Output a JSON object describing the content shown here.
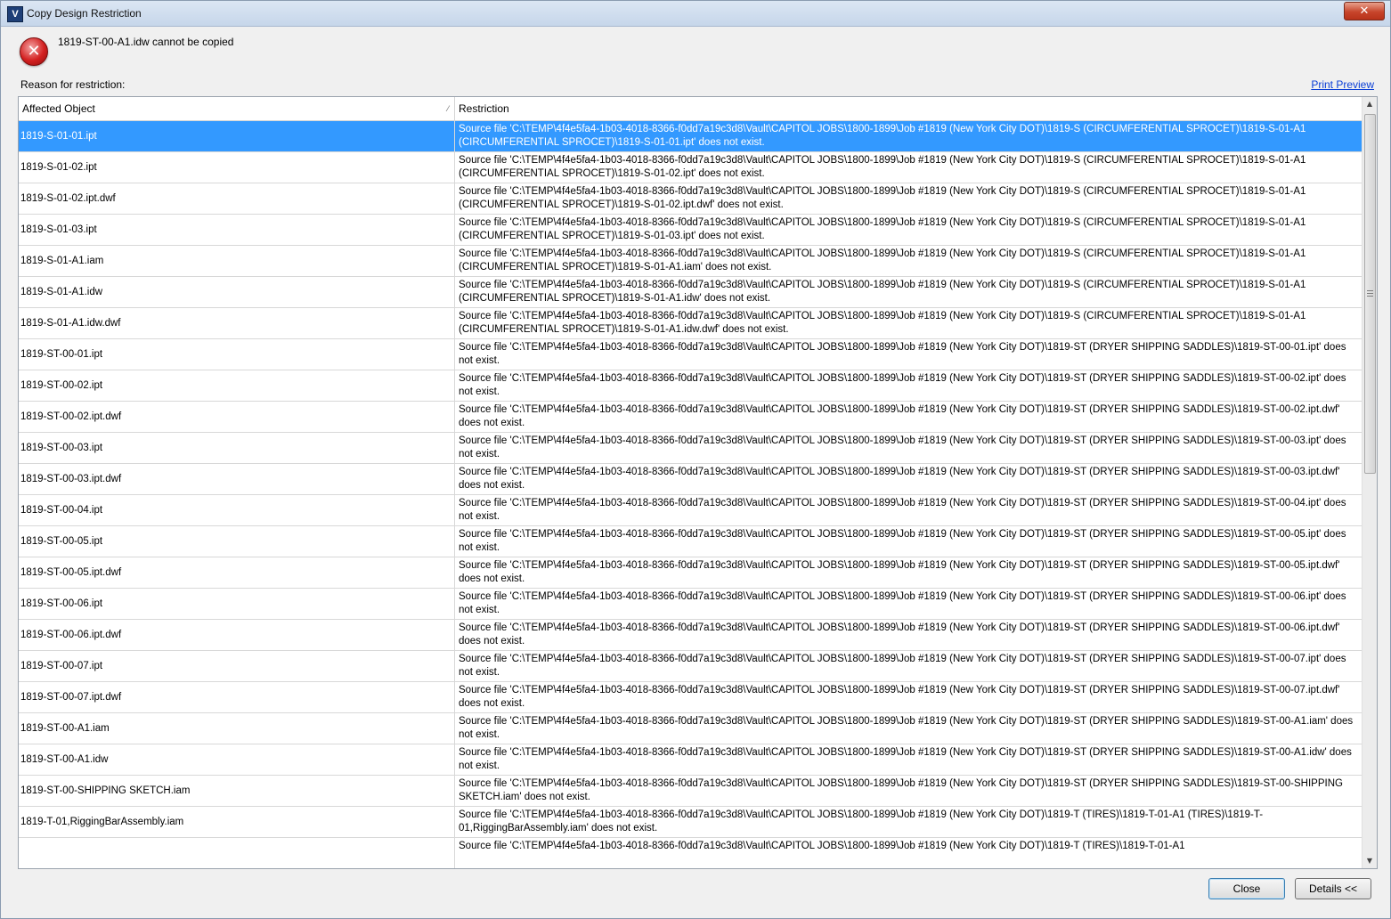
{
  "window": {
    "title": "Copy Design Restriction",
    "app_icon_glyph": "V",
    "close_glyph": "✕"
  },
  "message": {
    "icon": "error-icon",
    "text": "1819-ST-00-A1.idw cannot be copied"
  },
  "reason_label": "Reason for restriction:",
  "print_preview_label": "Print Preview",
  "table": {
    "columns": [
      "Affected Object",
      "Restriction"
    ],
    "selected_index": 0,
    "rows": [
      {
        "object": "1819-S-01-01.ipt",
        "restriction": "Source file 'C:\\TEMP\\4f4e5fa4-1b03-4018-8366-f0dd7a19c3d8\\Vault\\CAPITOL JOBS\\1800-1899\\Job #1819 (New York City DOT)\\1819-S (CIRCUMFERENTIAL SPROCET)\\1819-S-01-A1 (CIRCUMFERENTIAL SPROCET)\\1819-S-01-01.ipt' does not exist."
      },
      {
        "object": "1819-S-01-02.ipt",
        "restriction": "Source file 'C:\\TEMP\\4f4e5fa4-1b03-4018-8366-f0dd7a19c3d8\\Vault\\CAPITOL JOBS\\1800-1899\\Job #1819 (New York City DOT)\\1819-S (CIRCUMFERENTIAL SPROCET)\\1819-S-01-A1 (CIRCUMFERENTIAL SPROCET)\\1819-S-01-02.ipt' does not exist."
      },
      {
        "object": "1819-S-01-02.ipt.dwf",
        "restriction": "Source file 'C:\\TEMP\\4f4e5fa4-1b03-4018-8366-f0dd7a19c3d8\\Vault\\CAPITOL JOBS\\1800-1899\\Job #1819 (New York City DOT)\\1819-S (CIRCUMFERENTIAL SPROCET)\\1819-S-01-A1 (CIRCUMFERENTIAL SPROCET)\\1819-S-01-02.ipt.dwf' does not exist."
      },
      {
        "object": "1819-S-01-03.ipt",
        "restriction": "Source file 'C:\\TEMP\\4f4e5fa4-1b03-4018-8366-f0dd7a19c3d8\\Vault\\CAPITOL JOBS\\1800-1899\\Job #1819 (New York City DOT)\\1819-S (CIRCUMFERENTIAL SPROCET)\\1819-S-01-A1 (CIRCUMFERENTIAL SPROCET)\\1819-S-01-03.ipt' does not exist."
      },
      {
        "object": "1819-S-01-A1.iam",
        "restriction": "Source file 'C:\\TEMP\\4f4e5fa4-1b03-4018-8366-f0dd7a19c3d8\\Vault\\CAPITOL JOBS\\1800-1899\\Job #1819 (New York City DOT)\\1819-S (CIRCUMFERENTIAL SPROCET)\\1819-S-01-A1 (CIRCUMFERENTIAL SPROCET)\\1819-S-01-A1.iam' does not exist."
      },
      {
        "object": "1819-S-01-A1.idw",
        "restriction": "Source file 'C:\\TEMP\\4f4e5fa4-1b03-4018-8366-f0dd7a19c3d8\\Vault\\CAPITOL JOBS\\1800-1899\\Job #1819 (New York City DOT)\\1819-S (CIRCUMFERENTIAL SPROCET)\\1819-S-01-A1 (CIRCUMFERENTIAL SPROCET)\\1819-S-01-A1.idw' does not exist."
      },
      {
        "object": "1819-S-01-A1.idw.dwf",
        "restriction": "Source file 'C:\\TEMP\\4f4e5fa4-1b03-4018-8366-f0dd7a19c3d8\\Vault\\CAPITOL JOBS\\1800-1899\\Job #1819 (New York City DOT)\\1819-S (CIRCUMFERENTIAL SPROCET)\\1819-S-01-A1 (CIRCUMFERENTIAL SPROCET)\\1819-S-01-A1.idw.dwf' does not exist."
      },
      {
        "object": "1819-ST-00-01.ipt",
        "restriction": "Source file 'C:\\TEMP\\4f4e5fa4-1b03-4018-8366-f0dd7a19c3d8\\Vault\\CAPITOL JOBS\\1800-1899\\Job #1819 (New York City DOT)\\1819-ST (DRYER SHIPPING SADDLES)\\1819-ST-00-01.ipt' does not exist."
      },
      {
        "object": "1819-ST-00-02.ipt",
        "restriction": "Source file 'C:\\TEMP\\4f4e5fa4-1b03-4018-8366-f0dd7a19c3d8\\Vault\\CAPITOL JOBS\\1800-1899\\Job #1819 (New York City DOT)\\1819-ST (DRYER SHIPPING SADDLES)\\1819-ST-00-02.ipt' does not exist."
      },
      {
        "object": "1819-ST-00-02.ipt.dwf",
        "restriction": "Source file 'C:\\TEMP\\4f4e5fa4-1b03-4018-8366-f0dd7a19c3d8\\Vault\\CAPITOL JOBS\\1800-1899\\Job #1819 (New York City DOT)\\1819-ST (DRYER SHIPPING SADDLES)\\1819-ST-00-02.ipt.dwf' does not exist."
      },
      {
        "object": "1819-ST-00-03.ipt",
        "restriction": "Source file 'C:\\TEMP\\4f4e5fa4-1b03-4018-8366-f0dd7a19c3d8\\Vault\\CAPITOL JOBS\\1800-1899\\Job #1819 (New York City DOT)\\1819-ST (DRYER SHIPPING SADDLES)\\1819-ST-00-03.ipt' does not exist."
      },
      {
        "object": "1819-ST-00-03.ipt.dwf",
        "restriction": "Source file 'C:\\TEMP\\4f4e5fa4-1b03-4018-8366-f0dd7a19c3d8\\Vault\\CAPITOL JOBS\\1800-1899\\Job #1819 (New York City DOT)\\1819-ST (DRYER SHIPPING SADDLES)\\1819-ST-00-03.ipt.dwf' does not exist."
      },
      {
        "object": "1819-ST-00-04.ipt",
        "restriction": "Source file 'C:\\TEMP\\4f4e5fa4-1b03-4018-8366-f0dd7a19c3d8\\Vault\\CAPITOL JOBS\\1800-1899\\Job #1819 (New York City DOT)\\1819-ST (DRYER SHIPPING SADDLES)\\1819-ST-00-04.ipt' does not exist."
      },
      {
        "object": "1819-ST-00-05.ipt",
        "restriction": "Source file 'C:\\TEMP\\4f4e5fa4-1b03-4018-8366-f0dd7a19c3d8\\Vault\\CAPITOL JOBS\\1800-1899\\Job #1819 (New York City DOT)\\1819-ST (DRYER SHIPPING SADDLES)\\1819-ST-00-05.ipt' does not exist."
      },
      {
        "object": "1819-ST-00-05.ipt.dwf",
        "restriction": "Source file 'C:\\TEMP\\4f4e5fa4-1b03-4018-8366-f0dd7a19c3d8\\Vault\\CAPITOL JOBS\\1800-1899\\Job #1819 (New York City DOT)\\1819-ST (DRYER SHIPPING SADDLES)\\1819-ST-00-05.ipt.dwf' does not exist."
      },
      {
        "object": "1819-ST-00-06.ipt",
        "restriction": "Source file 'C:\\TEMP\\4f4e5fa4-1b03-4018-8366-f0dd7a19c3d8\\Vault\\CAPITOL JOBS\\1800-1899\\Job #1819 (New York City DOT)\\1819-ST (DRYER SHIPPING SADDLES)\\1819-ST-00-06.ipt' does not exist."
      },
      {
        "object": "1819-ST-00-06.ipt.dwf",
        "restriction": "Source file 'C:\\TEMP\\4f4e5fa4-1b03-4018-8366-f0dd7a19c3d8\\Vault\\CAPITOL JOBS\\1800-1899\\Job #1819 (New York City DOT)\\1819-ST (DRYER SHIPPING SADDLES)\\1819-ST-00-06.ipt.dwf' does not exist."
      },
      {
        "object": "1819-ST-00-07.ipt",
        "restriction": "Source file 'C:\\TEMP\\4f4e5fa4-1b03-4018-8366-f0dd7a19c3d8\\Vault\\CAPITOL JOBS\\1800-1899\\Job #1819 (New York City DOT)\\1819-ST (DRYER SHIPPING SADDLES)\\1819-ST-00-07.ipt' does not exist."
      },
      {
        "object": "1819-ST-00-07.ipt.dwf",
        "restriction": "Source file 'C:\\TEMP\\4f4e5fa4-1b03-4018-8366-f0dd7a19c3d8\\Vault\\CAPITOL JOBS\\1800-1899\\Job #1819 (New York City DOT)\\1819-ST (DRYER SHIPPING SADDLES)\\1819-ST-00-07.ipt.dwf' does not exist."
      },
      {
        "object": "1819-ST-00-A1.iam",
        "restriction": "Source file 'C:\\TEMP\\4f4e5fa4-1b03-4018-8366-f0dd7a19c3d8\\Vault\\CAPITOL JOBS\\1800-1899\\Job #1819 (New York City DOT)\\1819-ST (DRYER SHIPPING SADDLES)\\1819-ST-00-A1.iam' does not exist."
      },
      {
        "object": "1819-ST-00-A1.idw",
        "restriction": "Source file 'C:\\TEMP\\4f4e5fa4-1b03-4018-8366-f0dd7a19c3d8\\Vault\\CAPITOL JOBS\\1800-1899\\Job #1819 (New York City DOT)\\1819-ST (DRYER SHIPPING SADDLES)\\1819-ST-00-A1.idw' does not exist."
      },
      {
        "object": "1819-ST-00-SHIPPING SKETCH.iam",
        "restriction": "Source file 'C:\\TEMP\\4f4e5fa4-1b03-4018-8366-f0dd7a19c3d8\\Vault\\CAPITOL JOBS\\1800-1899\\Job #1819 (New York City DOT)\\1819-ST (DRYER SHIPPING SADDLES)\\1819-ST-00-SHIPPING SKETCH.iam' does not exist."
      },
      {
        "object": "1819-T-01,RiggingBarAssembly.iam",
        "restriction": "Source file 'C:\\TEMP\\4f4e5fa4-1b03-4018-8366-f0dd7a19c3d8\\Vault\\CAPITOL JOBS\\1800-1899\\Job #1819 (New York City DOT)\\1819-T (TIRES)\\1819-T-01-A1 (TIRES)\\1819-T-01,RiggingBarAssembly.iam' does not exist."
      },
      {
        "object": "",
        "restriction": "Source file 'C:\\TEMP\\4f4e5fa4-1b03-4018-8366-f0dd7a19c3d8\\Vault\\CAPITOL JOBS\\1800-1899\\Job #1819 (New York City DOT)\\1819-T (TIRES)\\1819-T-01-A1"
      }
    ]
  },
  "buttons": {
    "close": "Close",
    "details": "Details <<"
  },
  "scrollbar": {
    "up_glyph": "▲",
    "down_glyph": "▼"
  }
}
